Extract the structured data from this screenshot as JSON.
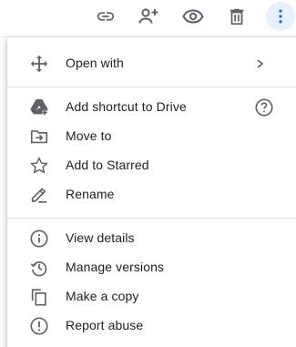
{
  "toolbar": {
    "buttons": [
      {
        "name": "link-icon",
        "label": "Get link"
      },
      {
        "name": "add-person-icon",
        "label": "Share"
      },
      {
        "name": "eye-icon",
        "label": "Preview"
      },
      {
        "name": "trash-icon",
        "label": "Remove"
      },
      {
        "name": "more-vertical-icon",
        "label": "More actions"
      }
    ]
  },
  "menu": {
    "group1": [
      {
        "icon": "move-arrows-icon",
        "label": "Open with",
        "submenu": true
      }
    ],
    "group2": [
      {
        "icon": "drive-shortcut-icon",
        "label": "Add shortcut to Drive",
        "help": true
      },
      {
        "icon": "move-folder-icon",
        "label": "Move to"
      },
      {
        "icon": "star-outline-icon",
        "label": "Add to Starred"
      },
      {
        "icon": "pencil-icon",
        "label": "Rename"
      }
    ],
    "group3": [
      {
        "icon": "info-icon",
        "label": "View details"
      },
      {
        "icon": "history-icon",
        "label": "Manage versions"
      },
      {
        "icon": "copy-icon",
        "label": "Make a copy"
      },
      {
        "icon": "report-icon",
        "label": "Report abuse"
      }
    ]
  },
  "colors": {
    "icon": "#5f6368",
    "text": "#202124",
    "active_bg": "#e8f0fe",
    "accent": "#1a73e8"
  }
}
